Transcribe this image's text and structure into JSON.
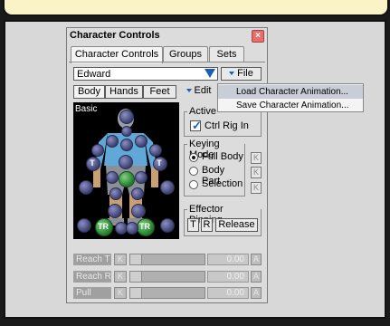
{
  "dialog": {
    "title": "Character Controls",
    "close_glyph": "×",
    "tabs": [
      {
        "label": "Character Controls",
        "active": true
      },
      {
        "label": "Groups",
        "active": false
      },
      {
        "label": "Sets",
        "active": false
      }
    ],
    "character_select": {
      "value": "Edward"
    },
    "file_button": "File",
    "segments": [
      "Body",
      "Hands",
      "Feet"
    ],
    "edit_button": "Edit",
    "panel_label": "Basic",
    "node_labels": {
      "t": "T",
      "tr": "TR"
    },
    "active_group": {
      "title": "Active",
      "checkbox_label": "Ctrl Rig In",
      "checked": true
    },
    "keying_mode": {
      "title": "Keying Mode",
      "options": [
        {
          "label": "Full Body",
          "selected": true
        },
        {
          "label": "Body Part",
          "selected": false
        },
        {
          "label": "Selection",
          "selected": false
        }
      ],
      "key_glyph": "K"
    },
    "effector_pinning": {
      "title": "Effector Pinning",
      "t_button": "T",
      "r_button": "R",
      "release_button": "Release"
    },
    "reach_rows": [
      {
        "label": "Reach T",
        "k": "K",
        "value": "0.00",
        "a": "A"
      },
      {
        "label": "Reach R",
        "k": "K",
        "value": "0.00",
        "a": "A"
      },
      {
        "label": "Pull",
        "k": "K",
        "value": "0.00",
        "a": "A"
      }
    ]
  },
  "file_menu": {
    "items": [
      {
        "label": "Load Character Animation...",
        "highlighted": true
      },
      {
        "label": "Save Character Animation...",
        "highlighted": false
      }
    ]
  },
  "colors": {
    "accent": "#1a5fb4",
    "effector_green": "#2a8a34",
    "effector_blue": "#4a4f8a",
    "callout": "#fbf3c8"
  }
}
